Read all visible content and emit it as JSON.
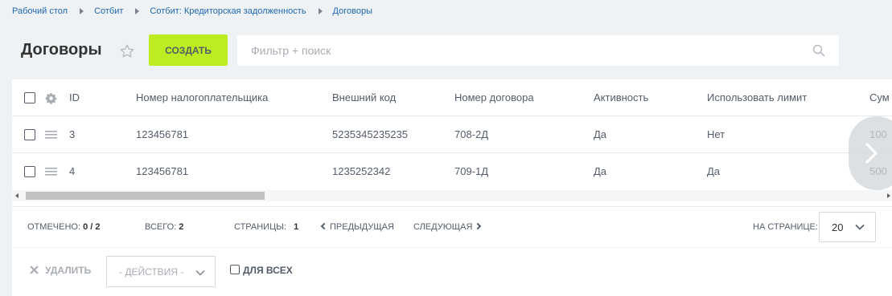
{
  "breadcrumb": [
    "Рабочий стол",
    "Сотбит",
    "Сотбит: Кредиторская задолженность",
    "Договоры"
  ],
  "header": {
    "title": "Договоры",
    "create_label": "Создать",
    "search_placeholder": "Фильтр + поиск"
  },
  "icons": [
    "star-icon",
    "search-icon",
    "gear-icon",
    "drag-icon",
    "chevron-right-icon",
    "close-icon",
    "chevron-down-icon"
  ],
  "table": {
    "columns": [
      "ID",
      "Номер налогоплательщика",
      "Внешний код",
      "Номер договора",
      "Активность",
      "Использовать лимит",
      "Сум"
    ],
    "rows": [
      {
        "id": "3",
        "inn": "123456781",
        "ext": "5235345235235",
        "num": "708-2Д",
        "active": "Да",
        "limit": "Нет",
        "sum": "100"
      },
      {
        "id": "4",
        "inn": "123456781",
        "ext": "1235252342",
        "num": "709-1Д",
        "active": "Да",
        "limit": "Да",
        "sum": "500"
      }
    ]
  },
  "nav": {
    "checked_label": "Отмечено:",
    "checked_value": "0 / 2",
    "total_label": "Всего:",
    "total_value": "2",
    "pages_label": "Страницы:",
    "pages_value": "1",
    "prev": "Предыдущая",
    "next": "Следующая",
    "per_page_label": "На странице:",
    "per_page_value": "20"
  },
  "actions": {
    "delete": "Удалить",
    "select_placeholder": "- Действия -",
    "for_all": "Для всех"
  },
  "colors": {
    "accent": "#bbed21",
    "link": "#2067b0",
    "background": "#eef2f4"
  }
}
